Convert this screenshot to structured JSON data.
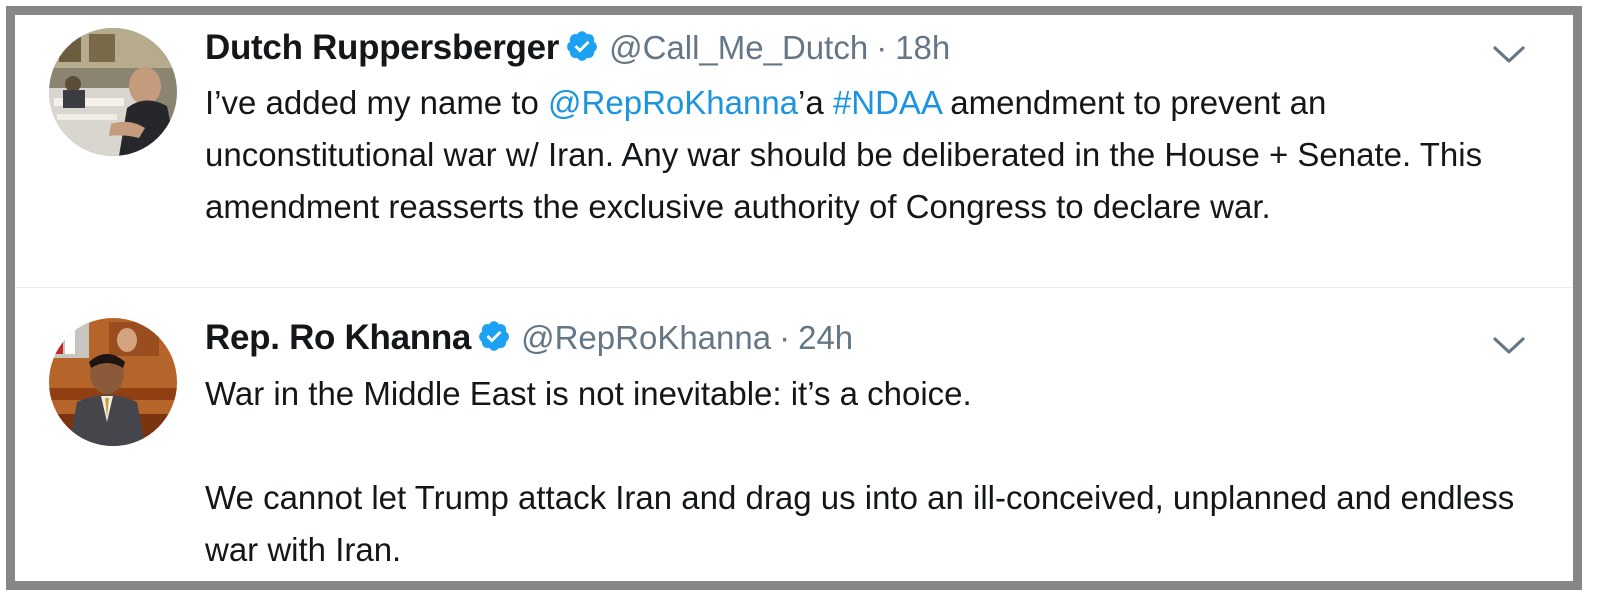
{
  "tweets": [
    {
      "display_name": "Dutch Ruppersberger",
      "handle": "@Call_Me_Dutch",
      "separator": "·",
      "time": "18h",
      "verified_icon": "verified-badge-icon",
      "menu_icon": "chevron-down-icon",
      "text": {
        "part1": "I’ve added my name to ",
        "mention": "@RepRoKhanna",
        "part2": "’a ",
        "hashtag": "#NDAA",
        "part3": " amendment to prevent an unconstitutional war w/ Iran. Any war should be deliberated in the House + Senate. This amendment reasserts the exclusive authority of Congress to declare war."
      }
    },
    {
      "display_name": "Rep. Ro Khanna",
      "handle": "@RepRoKhanna",
      "separator": "·",
      "time": "24h",
      "verified_icon": "verified-badge-icon",
      "menu_icon": "chevron-down-icon",
      "text": {
        "part1": "War in the Middle East is not inevitable: it’s a choice.\n\nWe cannot let Trump attack Iran and drag us into an ill-conceived, unplanned and endless war with Iran."
      }
    }
  ],
  "colors": {
    "link": "#1b95e0",
    "verified": "#1da1f2",
    "muted": "#657786",
    "text": "#14171a",
    "frame": "#878787"
  }
}
